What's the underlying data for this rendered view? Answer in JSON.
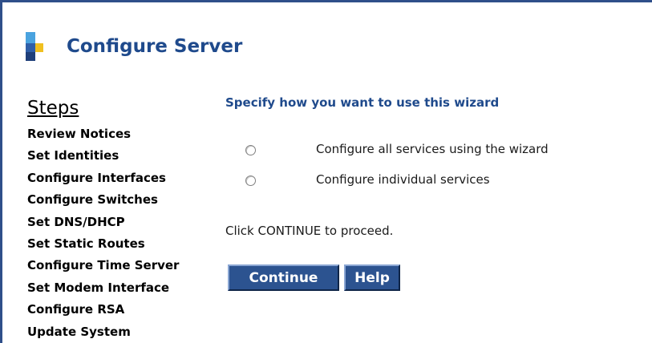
{
  "header": {
    "title": "Configure Server",
    "logo_colors": [
      "#2f5fa8",
      "#f0c020",
      "#4aa3df",
      "#1f3f7a"
    ]
  },
  "sidebar": {
    "heading": "Steps",
    "steps": [
      "Review Notices",
      "Set Identities",
      "Configure Interfaces",
      "Configure Switches",
      "Set DNS/DHCP",
      "Set Static Routes",
      "Configure Time Server",
      "Set Modem Interface",
      "Configure RSA",
      "Update System"
    ]
  },
  "main": {
    "prompt": "Specify how you want to use this wizard",
    "options": [
      {
        "label": "Configure all services using the wizard",
        "selected": false
      },
      {
        "label": "Configure individual services",
        "selected": false
      }
    ],
    "instruction": "Click CONTINUE to proceed.",
    "buttons": {
      "continue": "Continue",
      "help": "Help"
    }
  },
  "colors": {
    "accent": "#1f4a8c",
    "button_bg": "#2c5390",
    "frame_border": "#2f4f8a"
  }
}
